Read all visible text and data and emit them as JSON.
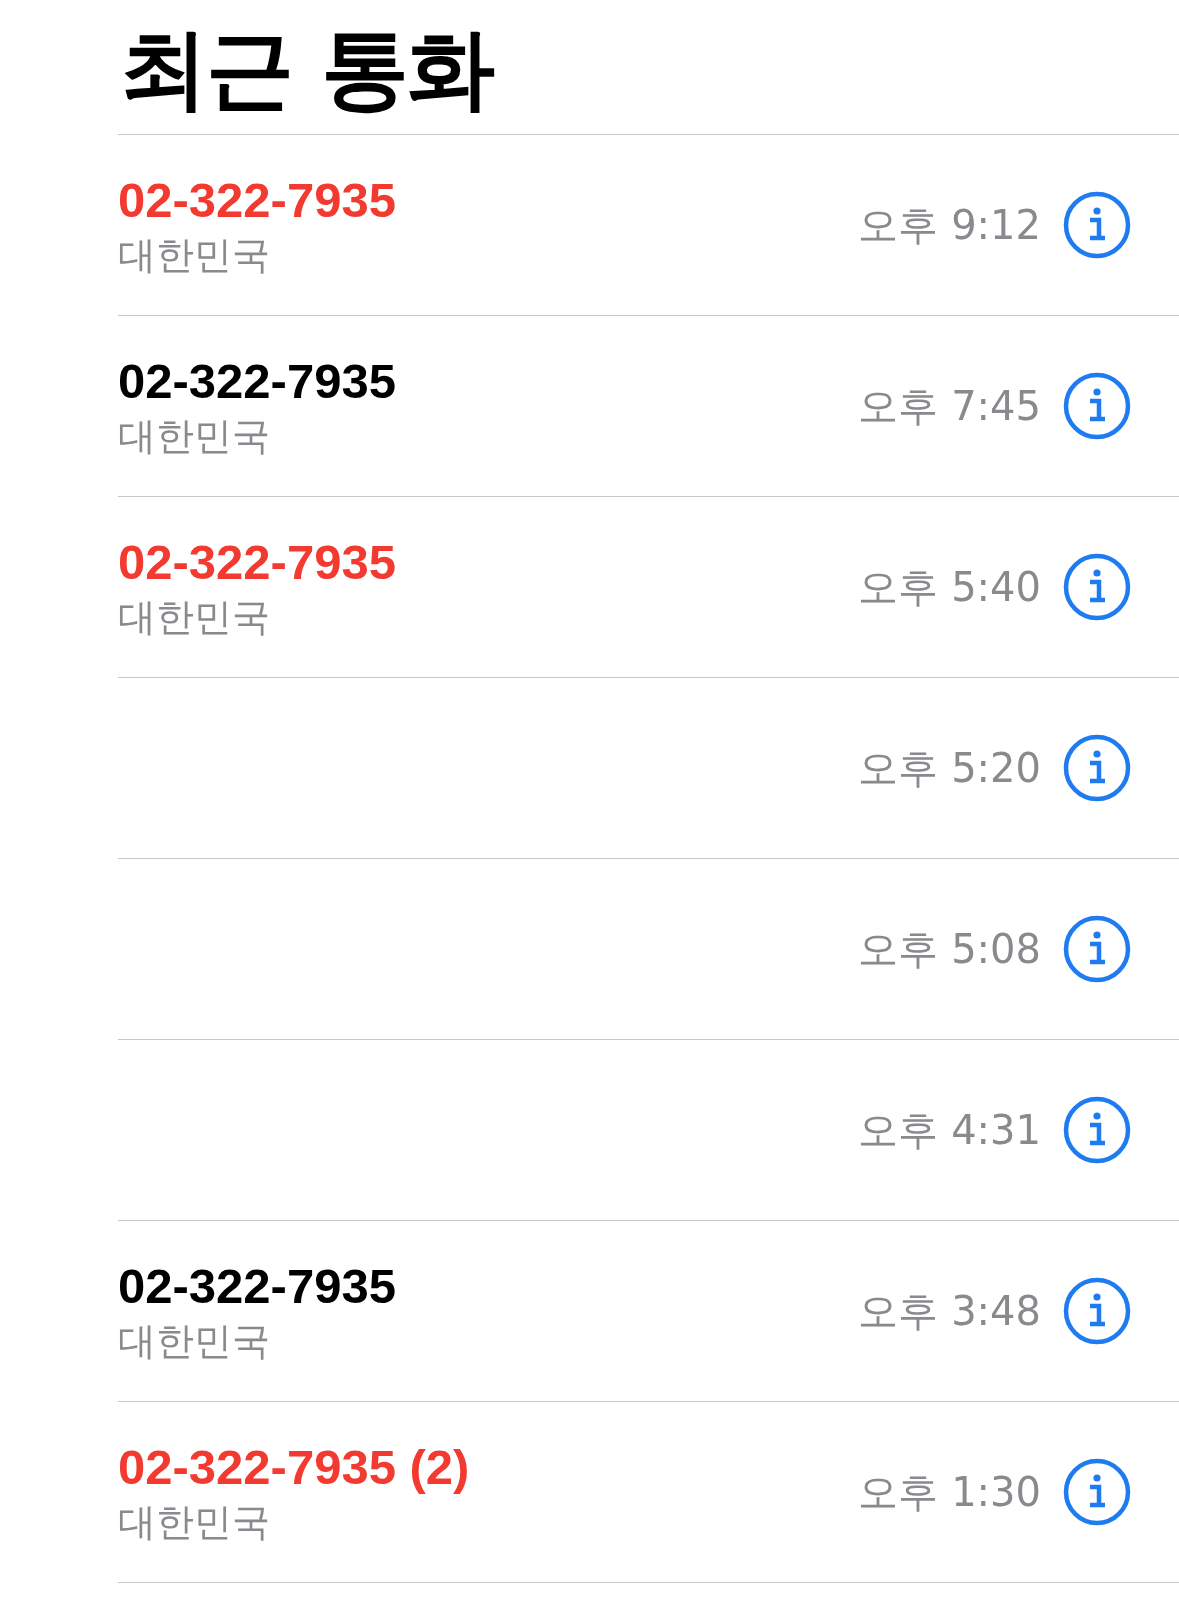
{
  "title": "최근 통화",
  "calls": [
    {
      "number": "02-322-7935",
      "missed": true,
      "location": "대한민국",
      "time": "오후 9:12"
    },
    {
      "number": "02-322-7935",
      "missed": false,
      "location": "대한민국",
      "time": "오후 7:45"
    },
    {
      "number": "02-322-7935",
      "missed": true,
      "location": "대한민국",
      "time": "오후 5:40"
    },
    {
      "time": "오후 5:20"
    },
    {
      "time": "오후 5:08"
    },
    {
      "time": "오후 4:31"
    },
    {
      "number": "02-322-7935",
      "missed": false,
      "location": "대한민국",
      "time": "오후 3:48"
    },
    {
      "number": "02-322-7935 (2)",
      "missed": true,
      "location": "대한민국",
      "time": "오후 1:30"
    }
  ]
}
